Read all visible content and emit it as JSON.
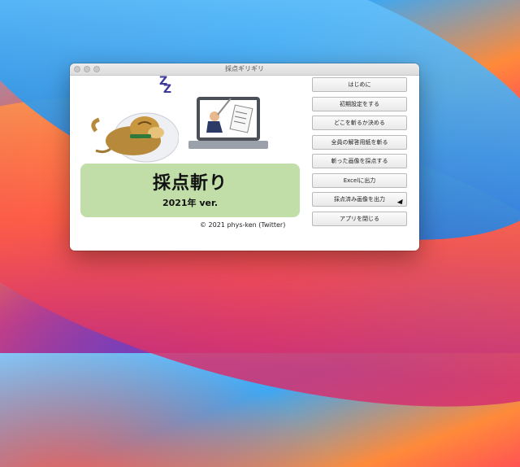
{
  "window": {
    "title": "採点ギリギリ"
  },
  "banner": {
    "title": "採点斬り",
    "subtitle": "2021年 ver."
  },
  "credit": "© 2021 phys-ken (Twitter)",
  "illustration": {
    "sleep_text": "Z\nZ Z"
  },
  "buttons": [
    {
      "label": "はじめに"
    },
    {
      "label": "初期設定をする"
    },
    {
      "label": "どこを斬るか決める"
    },
    {
      "label": "全員の解答用紙を斬る"
    },
    {
      "label": "斬った画像を採点する"
    },
    {
      "label": "Excelに出力"
    },
    {
      "label": "採点済み画像を出力"
    },
    {
      "label": "アプリを閉じる"
    }
  ]
}
